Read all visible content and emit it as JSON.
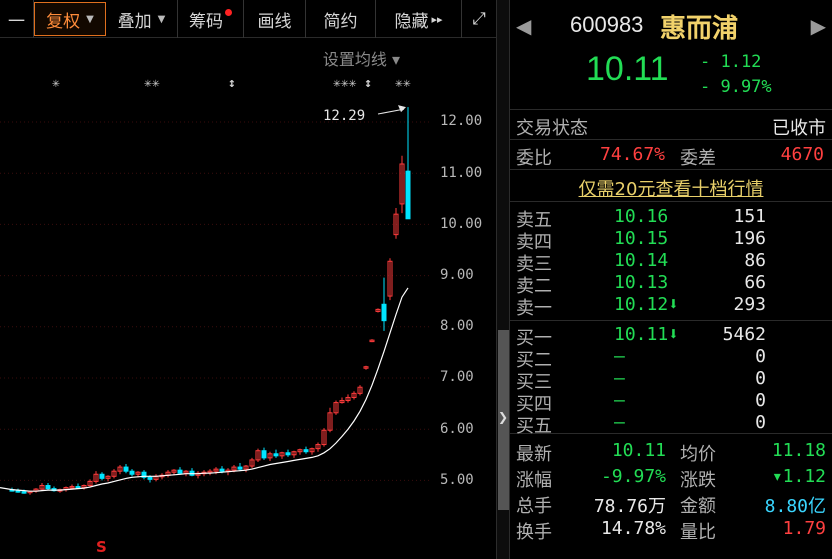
{
  "toolbar": {
    "items": [
      {
        "label": "一"
      },
      {
        "label": "复权",
        "caret": "▼"
      },
      {
        "label": "叠加",
        "caret": "▼"
      },
      {
        "label": "筹码"
      },
      {
        "label": "画线"
      },
      {
        "label": "简约"
      },
      {
        "label": "隐藏",
        "arrows": "▸▸"
      },
      {
        "label": "⤢"
      }
    ]
  },
  "chart": {
    "ma_setting": "设置均线 ▾",
    "high_label": "12.29",
    "price_axis": [
      "12.00",
      "11.00",
      "10.00",
      "9.00",
      "8.00",
      "7.00",
      "6.00",
      "5.00"
    ],
    "markers": [
      "✳",
      "✳✳",
      "↕",
      "✳✳✳ ↕",
      "✳✳"
    ],
    "signal": "S",
    "colors": {
      "up": "#ff3b3b",
      "down": "#00e5ff",
      "ma": "#ffffff",
      "grid": "#3a0d0d"
    }
  },
  "chart_data": {
    "type": "candlestick",
    "ylim": [
      4.6,
      12.6
    ],
    "candles": [
      [
        4.82,
        4.86,
        4.78,
        4.8
      ],
      [
        4.8,
        4.84,
        4.76,
        4.79
      ],
      [
        4.78,
        4.82,
        4.74,
        4.76
      ],
      [
        4.76,
        4.8,
        4.72,
        4.79
      ],
      [
        4.79,
        4.85,
        4.76,
        4.83
      ],
      [
        4.83,
        4.95,
        4.8,
        4.9
      ],
      [
        4.9,
        4.95,
        4.82,
        4.84
      ],
      [
        4.84,
        4.88,
        4.78,
        4.8
      ],
      [
        4.8,
        4.84,
        4.76,
        4.82
      ],
      [
        4.82,
        4.88,
        4.78,
        4.86
      ],
      [
        4.86,
        4.92,
        4.82,
        4.88
      ],
      [
        4.88,
        4.94,
        4.84,
        4.86
      ],
      [
        4.86,
        4.92,
        4.82,
        4.9
      ],
      [
        4.9,
        5.02,
        4.86,
        4.98
      ],
      [
        4.98,
        5.18,
        4.94,
        5.12
      ],
      [
        5.12,
        5.16,
        5.0,
        5.04
      ],
      [
        5.04,
        5.1,
        4.98,
        5.08
      ],
      [
        5.08,
        5.22,
        5.04,
        5.18
      ],
      [
        5.18,
        5.3,
        5.12,
        5.26
      ],
      [
        5.26,
        5.32,
        5.14,
        5.18
      ],
      [
        5.18,
        5.22,
        5.08,
        5.12
      ],
      [
        5.12,
        5.18,
        5.06,
        5.16
      ],
      [
        5.16,
        5.2,
        5.02,
        5.06
      ],
      [
        5.06,
        5.1,
        4.96,
        5.02
      ],
      [
        5.02,
        5.12,
        4.98,
        5.08
      ],
      [
        5.08,
        5.14,
        5.02,
        5.1
      ],
      [
        5.1,
        5.2,
        5.06,
        5.16
      ],
      [
        5.16,
        5.22,
        5.1,
        5.2
      ],
      [
        5.2,
        5.26,
        5.12,
        5.14
      ],
      [
        5.14,
        5.2,
        5.08,
        5.18
      ],
      [
        5.18,
        5.24,
        5.08,
        5.1
      ],
      [
        5.1,
        5.18,
        5.04,
        5.14
      ],
      [
        5.14,
        5.2,
        5.08,
        5.16
      ],
      [
        5.16,
        5.22,
        5.1,
        5.18
      ],
      [
        5.18,
        5.26,
        5.12,
        5.22
      ],
      [
        5.22,
        5.28,
        5.14,
        5.18
      ],
      [
        5.18,
        5.24,
        5.1,
        5.2
      ],
      [
        5.2,
        5.3,
        5.16,
        5.26
      ],
      [
        5.26,
        5.34,
        5.18,
        5.22
      ],
      [
        5.22,
        5.3,
        5.16,
        5.28
      ],
      [
        5.28,
        5.44,
        5.24,
        5.4
      ],
      [
        5.4,
        5.62,
        5.36,
        5.58
      ],
      [
        5.58,
        5.64,
        5.4,
        5.44
      ],
      [
        5.44,
        5.56,
        5.38,
        5.52
      ],
      [
        5.52,
        5.6,
        5.44,
        5.48
      ],
      [
        5.48,
        5.56,
        5.42,
        5.54
      ],
      [
        5.54,
        5.6,
        5.46,
        5.5
      ],
      [
        5.5,
        5.58,
        5.44,
        5.56
      ],
      [
        5.56,
        5.62,
        5.5,
        5.6
      ],
      [
        5.6,
        5.66,
        5.52,
        5.56
      ],
      [
        5.56,
        5.64,
        5.5,
        5.62
      ],
      [
        5.62,
        5.74,
        5.56,
        5.7
      ],
      [
        5.7,
        6.02,
        5.66,
        5.98
      ],
      [
        5.98,
        6.42,
        5.94,
        6.32
      ],
      [
        6.32,
        6.56,
        6.28,
        6.52
      ],
      [
        6.52,
        6.62,
        6.5,
        6.56
      ],
      [
        6.56,
        6.68,
        6.52,
        6.62
      ],
      [
        6.62,
        6.74,
        6.58,
        6.7
      ],
      [
        6.7,
        6.86,
        6.66,
        6.82
      ],
      [
        7.2,
        7.24,
        7.16,
        7.22
      ],
      [
        7.72,
        7.76,
        7.7,
        7.74
      ],
      [
        8.3,
        8.36,
        8.28,
        8.34
      ],
      [
        8.44,
        8.96,
        7.92,
        8.12
      ],
      [
        8.6,
        9.34,
        8.52,
        9.28
      ],
      [
        9.8,
        10.32,
        9.72,
        10.2
      ],
      [
        10.4,
        11.34,
        10.22,
        11.18
      ],
      [
        11.04,
        12.29,
        10.11,
        10.11
      ]
    ],
    "ma": [
      4.82,
      4.81,
      4.8,
      4.79,
      4.79,
      4.8,
      4.81,
      4.81,
      4.81,
      4.82,
      4.83,
      4.84,
      4.85,
      4.87,
      4.9,
      4.93,
      4.95,
      4.98,
      5.01,
      5.04,
      5.06,
      5.07,
      5.08,
      5.08,
      5.08,
      5.09,
      5.1,
      5.11,
      5.12,
      5.13,
      5.13,
      5.13,
      5.14,
      5.14,
      5.15,
      5.16,
      5.17,
      5.18,
      5.19,
      5.2,
      5.22,
      5.25,
      5.28,
      5.31,
      5.33,
      5.35,
      5.37,
      5.39,
      5.41,
      5.43,
      5.45,
      5.48,
      5.54,
      5.62,
      5.73,
      5.86,
      6.0,
      6.16,
      6.35,
      6.58,
      6.86,
      7.18,
      7.52,
      7.88,
      8.24,
      8.58,
      8.76
    ]
  },
  "quote": {
    "code": "600983",
    "name": "惠而浦",
    "price": "10.11",
    "change": "- 1.12",
    "change_pct": "- 9.97%",
    "trade_status_label": "交易状态",
    "trade_status": "已收市",
    "weibi_label": "委比",
    "weibi": "74.67%",
    "weicha_label": "委差",
    "weicha": "4670",
    "ten_level": "仅需20元查看十档行情"
  },
  "sell": [
    {
      "label": "卖五",
      "price": "10.16",
      "vol": "151"
    },
    {
      "label": "卖四",
      "price": "10.15",
      "vol": "196"
    },
    {
      "label": "卖三",
      "price": "10.14",
      "vol": "86"
    },
    {
      "label": "卖二",
      "price": "10.13",
      "vol": "66"
    },
    {
      "label": "卖一",
      "price": "10.12⬇",
      "vol": "293"
    }
  ],
  "buy": [
    {
      "label": "买一",
      "price": "10.11⬇",
      "vol": "5462"
    },
    {
      "label": "买二",
      "price": "—",
      "vol": "0"
    },
    {
      "label": "买三",
      "price": "—",
      "vol": "0"
    },
    {
      "label": "买四",
      "price": "—",
      "vol": "0"
    },
    {
      "label": "买五",
      "price": "—",
      "vol": "0"
    }
  ],
  "stats": [
    {
      "l1": "最新",
      "v1": "10.11",
      "c1": "#22dd55",
      "l2": "均价",
      "v2": "11.18",
      "c2": "#22dd55"
    },
    {
      "l1": "涨幅",
      "v1": "-9.97%",
      "c1": "#22dd55",
      "l2": "涨跌",
      "v2": "▾1.12",
      "c2": "#22dd55"
    },
    {
      "l1": "总手",
      "v1": "78.76万",
      "c1": "#e8e8e8",
      "l2": "金额",
      "v2": "8.80亿",
      "c2": "#3ad6ff"
    },
    {
      "l1": "换手",
      "v1": "14.78%",
      "c1": "#e8e8e8",
      "l2": "量比",
      "v2": "1.79",
      "c2": "#ff4040"
    }
  ]
}
